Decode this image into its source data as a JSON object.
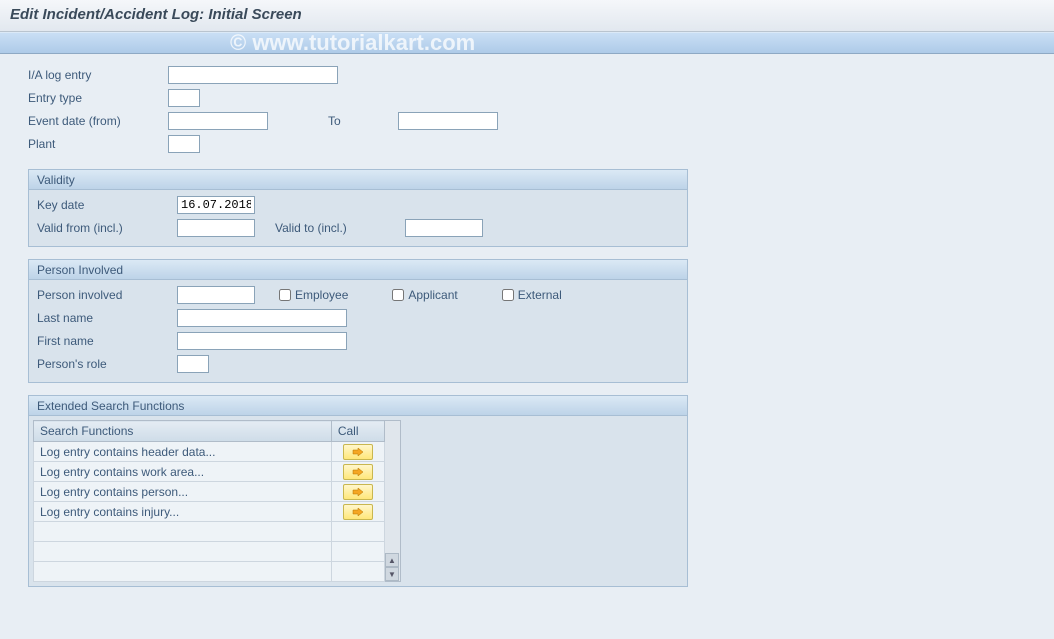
{
  "header": {
    "title": "Edit Incident/Accident Log: Initial Screen"
  },
  "watermark": "© www.tutorialkart.com",
  "filters": {
    "ia_log_entry_label": "I/A log entry",
    "ia_log_entry": "",
    "entry_type_label": "Entry type",
    "entry_type": "",
    "event_date_from_label": "Event date (from)",
    "event_date_from": "",
    "event_date_to_label": "To",
    "event_date_to": "",
    "plant_label": "Plant",
    "plant": ""
  },
  "validity": {
    "title": "Validity",
    "key_date_label": "Key date",
    "key_date": "16.07.2018",
    "valid_from_label": "Valid from (incl.)",
    "valid_from": "",
    "valid_to_label": "Valid to (incl.)",
    "valid_to": ""
  },
  "person": {
    "title": "Person Involved",
    "person_involved_label": "Person involved",
    "person_involved": "",
    "employee_label": "Employee",
    "applicant_label": "Applicant",
    "external_label": "External",
    "last_name_label": "Last name",
    "last_name": "",
    "first_name_label": "First name",
    "first_name": "",
    "person_role_label": "Person's role",
    "person_role": ""
  },
  "extended": {
    "title": "Extended Search Functions",
    "col_func": "Search Functions",
    "col_call": "Call",
    "rows": [
      {
        "label": "Log entry contains header data..."
      },
      {
        "label": "Log entry contains work area..."
      },
      {
        "label": "Log entry contains person..."
      },
      {
        "label": "Log entry contains injury..."
      }
    ]
  }
}
